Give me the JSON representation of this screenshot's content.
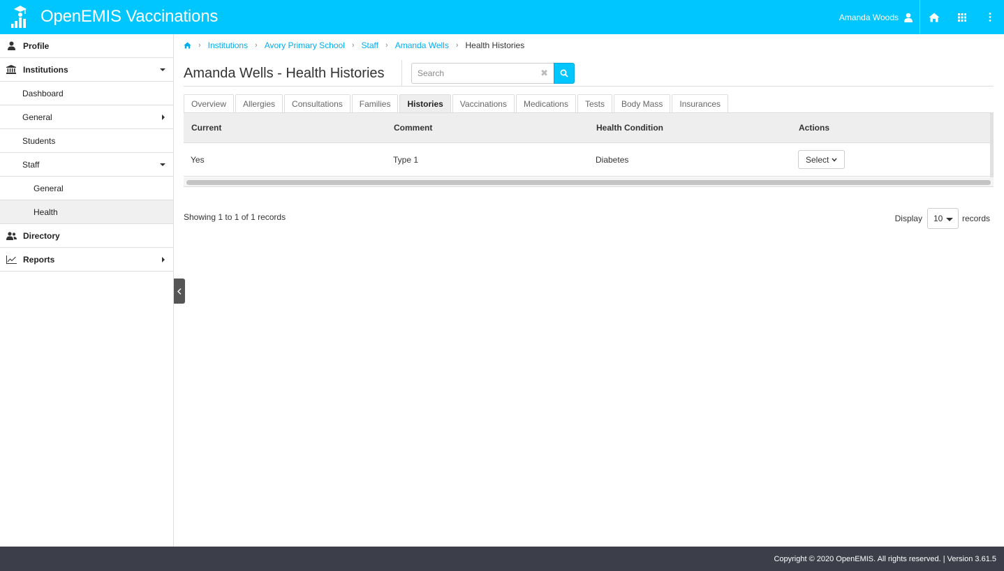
{
  "app": {
    "title": "OpenEMIS Vaccinations",
    "user_name": "Amanda Woods",
    "accent_color": "#00c6ff",
    "icons": [
      "openemis-logo-icon",
      "user-icon",
      "home-icon",
      "apps-grid-icon",
      "more-vertical-icon"
    ]
  },
  "sidebar": {
    "profile": "Profile",
    "institutions": "Institutions",
    "dashboard": "Dashboard",
    "general": "General",
    "students": "Students",
    "staff": "Staff",
    "staff_general": "General",
    "staff_health": "Health",
    "directory": "Directory",
    "reports": "Reports"
  },
  "breadcrumb": {
    "items": [
      "Institutions",
      "Avory Primary School",
      "Staff",
      "Amanda Wells"
    ],
    "current": "Health Histories"
  },
  "page": {
    "title": "Amanda Wells - Health Histories"
  },
  "search": {
    "placeholder": "Search",
    "value": ""
  },
  "tabs": {
    "items": [
      "Overview",
      "Allergies",
      "Consultations",
      "Families",
      "Histories",
      "Vaccinations",
      "Medications",
      "Tests",
      "Body Mass",
      "Insurances"
    ],
    "active": "Histories"
  },
  "table": {
    "columns": [
      "Current",
      "Comment",
      "Health Condition",
      "Actions"
    ],
    "rows": [
      {
        "current": "Yes",
        "comment": "Type 1",
        "health_condition": "Diabetes",
        "action_label": "Select"
      }
    ]
  },
  "pagination": {
    "info": "Showing 1 to 1 of 1 records",
    "display_label": "Display",
    "page_size": "10",
    "records_label": "records"
  },
  "footer": {
    "text": "Copyright © 2020 OpenEMIS. All rights reserved. | Version 3.61.5"
  }
}
